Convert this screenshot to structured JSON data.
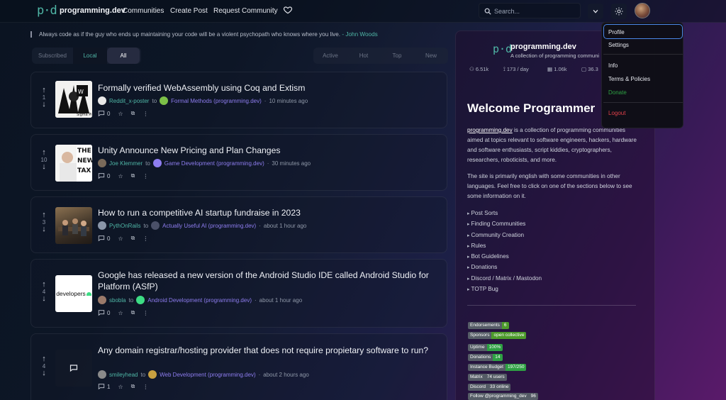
{
  "nav": {
    "logo": "p·d",
    "brand": "programming.dev",
    "links": [
      "Communities",
      "Create Post",
      "Request Community"
    ],
    "search_placeholder": "Search..."
  },
  "quote": {
    "text": "Always code as if the guy who ends up maintaining your code will be a violent psychopath who knows where you live.",
    "author": "- John Woods"
  },
  "filters": {
    "listing": [
      "Subscribed",
      "Local",
      "All"
    ],
    "active_listing": "All",
    "sort": [
      "Active",
      "Hot",
      "Top",
      "New"
    ]
  },
  "posts": [
    {
      "score": "1",
      "title": "Formally verified WebAssembly using Coq and Extism",
      "user": "Reddit_x-poster",
      "community": "Formal Methods (programming.dev)",
      "time": "10 minutes ago",
      "comments": "0",
      "thumb_text": "Sigma Pi"
    },
    {
      "score": "10",
      "title": "Unity Announce New Pricing and Plan Changes",
      "user": "Joe Klemmer",
      "community": "Game Development (programming.dev)",
      "time": "30 minutes ago",
      "comments": "0",
      "thumb_text": "THE NEW TAX"
    },
    {
      "score": "3",
      "title": "How to run a competitive AI startup fundraise in 2023",
      "user": "PythOnRails",
      "community": "Actually Useful AI (programming.dev)",
      "time": "about 1 hour ago",
      "comments": "0",
      "thumb_text": ""
    },
    {
      "score": "4",
      "title": "Google has released a new version of the Android Studio IDE called Android Studio for Platform (ASfP)",
      "user": "sbobla",
      "community": "Android Development (programming.dev)",
      "time": "about 1 hour ago",
      "comments": "0",
      "thumb_text": "developers"
    },
    {
      "score": "4",
      "title": "Any domain registrar/hosting provider that does not require propietary software to run?",
      "user": "smileyhead",
      "community": "Web Development (programming.dev)",
      "time": "about 2 hours ago",
      "comments": "1",
      "thumb_text": ""
    }
  ],
  "sidebar": {
    "name": "programming.dev",
    "description": "A collection of programming communi",
    "stats": [
      "6.51k",
      "173 / day",
      "1.06k",
      "36.3"
    ],
    "welcome": "Welcome Programmer",
    "intro_link": "programming.dev",
    "intro_rest": " is a collection of programming communities aimed at topics relevant to software engineers, hackers, hardware and software enthusiasts, script kiddies, cryptographers, researchers, roboticists, and more.",
    "intro2": "The site is primarily english with some communities in other languages. Feel free to click on one of the sections below to see some information on it.",
    "sections": [
      "Post Sorts",
      "Finding Communities",
      "Community Creation",
      "Rules",
      "Bot Guidelines",
      "Donations",
      "Discord / Matrix / Mastodon",
      "TOTP Bug"
    ],
    "badges": [
      {
        "label": "Endorsements",
        "value": "6",
        "color": "#4c9a2a"
      },
      {
        "label": "Sponsors",
        "value": "open collective",
        "color": "#4c9a2a"
      },
      {
        "label": "Uptime",
        "value": "100%",
        "color": "#2ea043"
      },
      {
        "label": "Donations",
        "value": "14",
        "color": "#2ea043"
      },
      {
        "label": "Instance Budget",
        "value": "197/250",
        "color": "#2ea043"
      },
      {
        "label": "Matrix",
        "value": "74 users",
        "color": "#555c66"
      },
      {
        "label": "Discord",
        "value": "33 online",
        "color": "#555c66"
      },
      {
        "label": "Follow @programming_dev",
        "value": "96",
        "color": "#555c66"
      }
    ]
  },
  "dropdown": {
    "items": [
      "Profile",
      "Settings",
      "Info",
      "Terms & Policies",
      "Donate",
      "Logout"
    ]
  },
  "colors": {
    "accent": "#4fb6a6",
    "community": "#8e7df0",
    "donate": "#2ea043",
    "logout": "#e0404a",
    "focus": "#4a86e6"
  }
}
